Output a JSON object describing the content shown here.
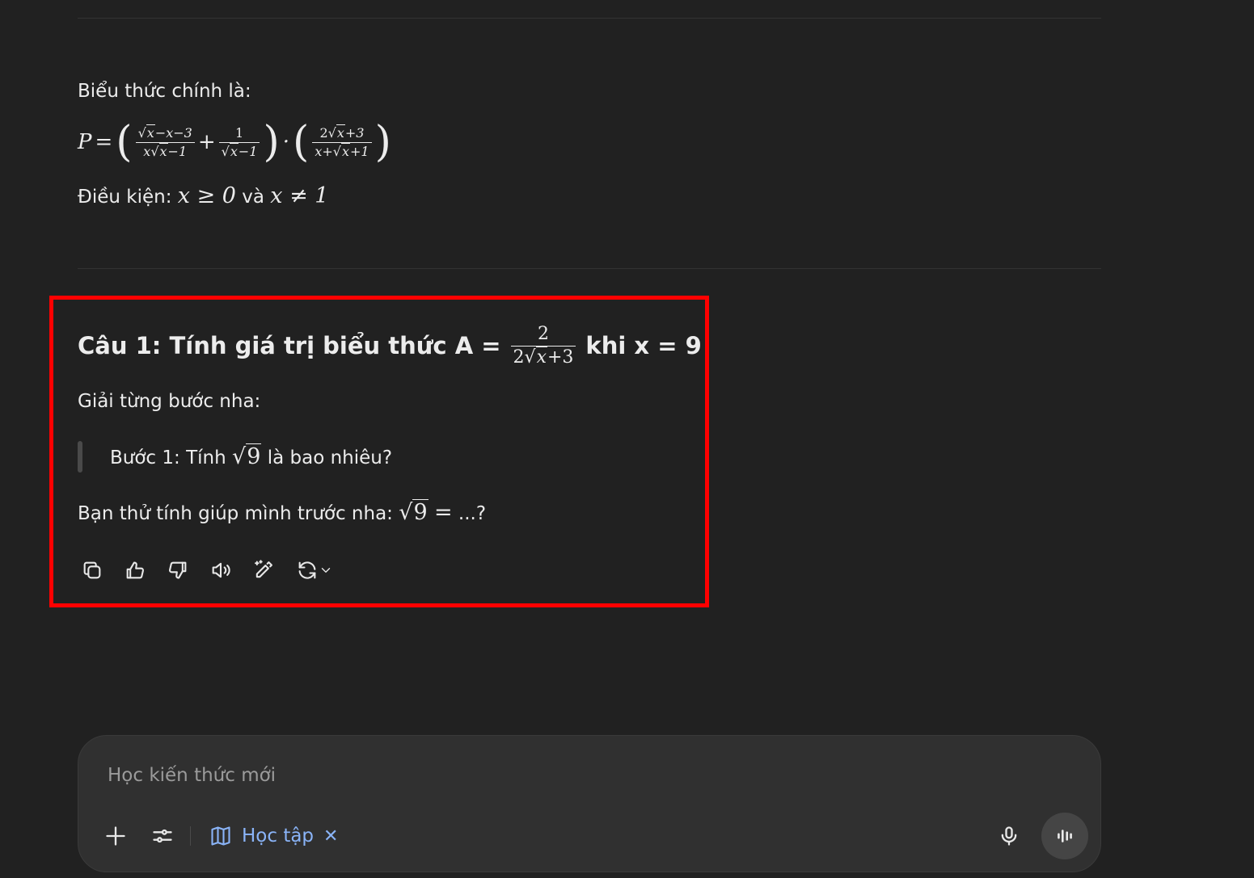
{
  "context": {
    "intro": "Biểu thức chính là:",
    "formula": {
      "lhs": "P",
      "eq": "=",
      "frac1_num_rest": "−x−3",
      "frac1_den_x": "x",
      "frac1_den_rest": "−1",
      "plus": "+",
      "frac2_num": "1",
      "frac2_den_rest": "−1",
      "dot": "·",
      "frac3_num_two": "2",
      "frac3_num_rest": "+3",
      "frac3_den_x": "x+",
      "frac3_den_rest": "+1",
      "var": "x"
    },
    "condition_label": "Điều kiện:",
    "condition_1": "x ≥ 0",
    "condition_join": "và",
    "condition_2": "x ≠ 1"
  },
  "message": {
    "heading_prefix": "Câu 1: Tính giá trị biểu thức A =",
    "heading_frac_num": "2",
    "heading_frac_den_two": "2",
    "heading_frac_den_var": "x",
    "heading_frac_den_rest": "+3",
    "heading_suffix": "khi x = 9",
    "step_intro": "Giải từng bước nha:",
    "step_quote_prefix": "Bước 1: Tính",
    "step_quote_sqrt": "9",
    "step_quote_suffix": "là bao nhiêu?",
    "prompt_prefix": "Bạn thử tính giúp mình trước nha:",
    "prompt_sqrt": "9",
    "prompt_eq": "=",
    "prompt_suffix": "...?"
  },
  "actions": {
    "icons": [
      "copy-icon",
      "thumbs-up-icon",
      "thumbs-down-icon",
      "read-aloud-icon",
      "edit-icon",
      "regenerate-icon",
      "chevron-down-icon"
    ]
  },
  "composer": {
    "placeholder": "Học kiến thức mới",
    "tool_label": "Học tập",
    "tool_close": "✕",
    "icons": [
      "plus-icon",
      "tools-icon",
      "book-icon",
      "close-icon",
      "mic-icon",
      "voice-mode-icon"
    ]
  },
  "colors": {
    "background": "#212121",
    "highlight_border": "#ff0000",
    "accent_blue": "#8ab4f8",
    "composer_bg": "#303030"
  }
}
